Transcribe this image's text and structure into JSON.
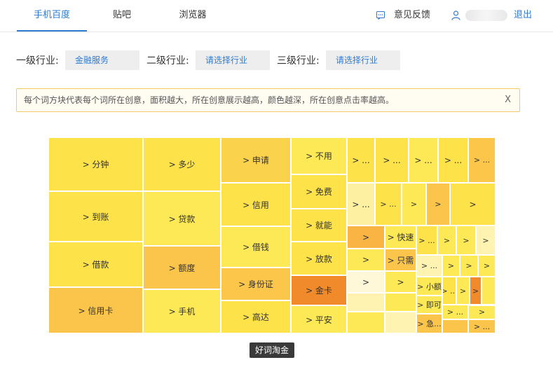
{
  "nav": {
    "tabs": [
      {
        "label": "手机百度",
        "active": true
      },
      {
        "label": "贴吧",
        "active": false
      },
      {
        "label": "浏览器",
        "active": false
      }
    ],
    "feedback_label": "意见反馈",
    "logout_label": "退出"
  },
  "filters": {
    "level1": {
      "label": "一级行业:",
      "value": "金融服务"
    },
    "level2": {
      "label": "二级行业:",
      "value": "请选择行业"
    },
    "level3": {
      "label": "三级行业:",
      "value": "请选择行业"
    }
  },
  "notice": {
    "text": "每个词方块代表每个词所在创意，面积越大，所在创意展示越高，颜色越深，所在创意点击率越高。",
    "close_label": "X"
  },
  "treemap": {
    "cells": [
      {
        "label": "> 分钟",
        "color": "#fde24a"
      },
      {
        "label": "> 到账",
        "color": "#fde24a"
      },
      {
        "label": "> 借款",
        "color": "#fde24a"
      },
      {
        "label": "> 信用卡",
        "color": "#fac54a"
      },
      {
        "label": "> 多少",
        "color": "#fde24a"
      },
      {
        "label": "> 贷款",
        "color": "#fde955"
      },
      {
        "label": "> 额度",
        "color": "#fac54a"
      },
      {
        "label": "> 手机",
        "color": "#fde955"
      },
      {
        "label": "> 申请",
        "color": "#fbd24b"
      },
      {
        "label": "> 信用",
        "color": "#fde24a"
      },
      {
        "label": "> 借钱",
        "color": "#fde955"
      },
      {
        "label": "> 身份证",
        "color": "#fbc64a"
      },
      {
        "label": "> 高达",
        "color": "#fde24a"
      },
      {
        "label": "> 不用",
        "color": "#fde955"
      },
      {
        "label": "> 免费",
        "color": "#fde24a"
      },
      {
        "label": "> 就能",
        "color": "#fde24a"
      },
      {
        "label": "> 放款",
        "color": "#fde24a"
      },
      {
        "label": "> 金卡",
        "color": "#f08a2a"
      },
      {
        "label": "> 平安",
        "color": "#fde955"
      },
      {
        "label": "> ...",
        "color": "#fde24a"
      },
      {
        "label": "> ...",
        "color": "#fde24a"
      },
      {
        "label": "> ...",
        "color": "#fde955"
      },
      {
        "label": "> ...",
        "color": "#fde24a"
      },
      {
        "label": "> ...",
        "color": "#fbc64a"
      },
      {
        "label": "> ...",
        "color": "#fdf0a0"
      },
      {
        "label": "> ...",
        "color": "#fde24a"
      },
      {
        "label": ">",
        "color": "#fde955"
      },
      {
        "label": ">",
        "color": "#fac54a"
      },
      {
        "label": ">",
        "color": "#fde24a"
      },
      {
        "label": ">",
        "color": "#f9b444"
      },
      {
        "label": "> 快速",
        "color": "#fde955"
      },
      {
        "label": "> ...",
        "color": "#fde24a"
      },
      {
        "label": ">",
        "color": "#fde955"
      },
      {
        "label": ">",
        "color": "#fde955"
      },
      {
        "label": ">",
        "color": "#fef3b0"
      },
      {
        "label": ">",
        "color": "#fde955"
      },
      {
        "label": "> 只需",
        "color": "#fac54a"
      },
      {
        "label": "> ...",
        "color": "#fef3b0"
      },
      {
        "label": ">",
        "color": "#fde955"
      },
      {
        "label": ">",
        "color": "#fde955"
      },
      {
        "label": ">",
        "color": "#fde955"
      },
      {
        "label": ">",
        "color": "#fef8d8"
      },
      {
        "label": ">",
        "color": "#fde955"
      },
      {
        "label": "> 小额",
        "color": "#fde955"
      },
      {
        "label": "> ...",
        "color": "#fde24a"
      },
      {
        "label": ">",
        "color": "#fde955"
      },
      {
        "label": ">",
        "color": "#f08a2a"
      },
      {
        "label": "",
        "color": "#fde955"
      },
      {
        "label": "",
        "color": "#fef3b0"
      },
      {
        "label": "",
        "color": "#fde955"
      },
      {
        "label": "> 即可",
        "color": "#fde955"
      },
      {
        "label": "> ...",
        "color": "#fde955"
      },
      {
        "label": ">",
        "color": "#fde955"
      },
      {
        "label": "",
        "color": "#fac54a"
      },
      {
        "label": "",
        "color": "#fde955"
      },
      {
        "label": "",
        "color": "#fef3b0"
      },
      {
        "label": "> 急...",
        "color": "#fac54a"
      },
      {
        "label": "> ...",
        "color": "#fac54a"
      },
      {
        "label": ">",
        "color": "#fde955"
      },
      {
        "label": "",
        "color": "#fef3b0"
      },
      {
        "label": "",
        "color": "#fde955"
      },
      {
        "label": "",
        "color": "#fde955"
      }
    ]
  },
  "footer": {
    "badge": "好词淘金"
  },
  "colors": {
    "accent": "#2f7bd1",
    "notice_border": "#f3c86a"
  }
}
